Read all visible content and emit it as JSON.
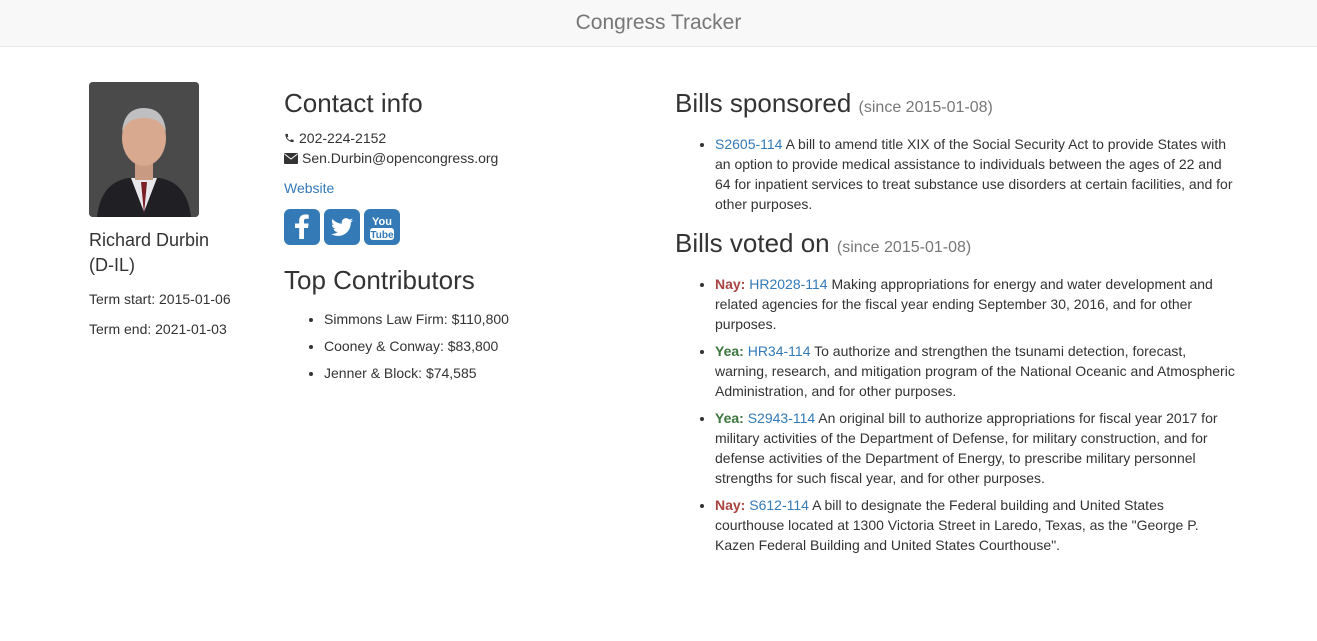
{
  "navbar": {
    "title": "Congress Tracker"
  },
  "profile": {
    "name": "Richard Durbin",
    "party": "(D-IL)",
    "term_start": "Term start: 2015-01-06",
    "term_end": "Term end: 2021-01-03",
    "photo_icon": "portrait-photo"
  },
  "contact": {
    "heading": "Contact info",
    "phone": "202-224-2152",
    "email": "Sen.Durbin@opencongress.org",
    "website_label": "Website",
    "social": [
      {
        "name": "facebook-icon"
      },
      {
        "name": "twitter-icon"
      },
      {
        "name": "youtube-icon"
      }
    ]
  },
  "contributors": {
    "heading": "Top Contributors",
    "items": [
      "Simmons Law Firm: $110,800",
      "Cooney & Conway: $83,800",
      "Jenner & Block: $74,585"
    ]
  },
  "bills_sponsored": {
    "heading": "Bills sponsored",
    "since": "(since 2015-01-08)",
    "items": [
      {
        "id": "S2605-114",
        "title": "A bill to amend title XIX of the Social Security Act to provide States with an option to provide medical assistance to individuals between the ages of 22 and 64 for inpatient services to treat substance use disorders at certain facilities, and for other purposes."
      }
    ]
  },
  "bills_voted": {
    "heading": "Bills voted on",
    "since": "(since 2015-01-08)",
    "items": [
      {
        "vote": "Nay:",
        "id": "HR2028-114",
        "title": "Making appropriations for energy and water development and related agencies for the fiscal year ending September 30, 2016, and for other purposes."
      },
      {
        "vote": "Yea:",
        "id": "HR34-114",
        "title": "To authorize and strengthen the tsunami detection, forecast, warning, research, and mitigation program of the National Oceanic and Atmospheric Administration, and for other purposes."
      },
      {
        "vote": "Yea:",
        "id": "S2943-114",
        "title": "An original bill to authorize appropriations for fiscal year 2017 for military activities of the Department of Defense, for military construction, and for defense activities of the Department of Energy, to prescribe military personnel strengths for such fiscal year, and for other purposes."
      },
      {
        "vote": "Nay:",
        "id": "S612-114",
        "title": "A bill to designate the Federal building and United States courthouse located at 1300 Victoria Street in Laredo, Texas, as the \"George P. Kazen Federal Building and United States Courthouse\"."
      }
    ]
  },
  "colors": {
    "link": "#337ab7",
    "nay": "#a94442",
    "yea": "#3c763d",
    "muted": "#777777"
  }
}
